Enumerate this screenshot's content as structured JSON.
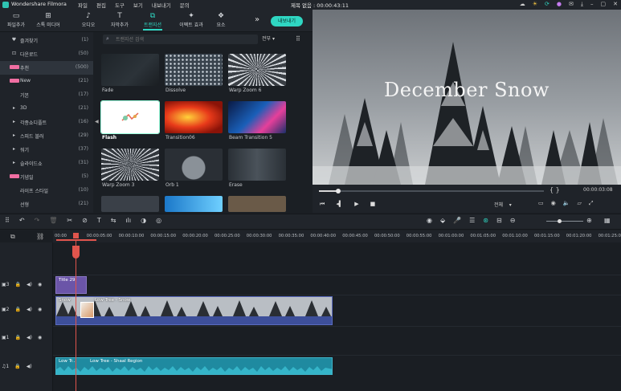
{
  "app": {
    "name": "Wondershare Filmora",
    "menu": [
      "파일",
      "편집",
      "도구",
      "보기",
      "내보내기",
      "문의"
    ],
    "project_title": "제목 없음 : 00:00:43:11"
  },
  "toolbar": {
    "items": [
      {
        "label": "파일추가",
        "icon": "folder-icon"
      },
      {
        "label": "스톡 미디어",
        "icon": "stock-icon"
      },
      {
        "label": "오디오",
        "icon": "music-icon"
      },
      {
        "label": "자막추가",
        "icon": "text-icon"
      },
      {
        "label": "트랜지션",
        "icon": "transition-icon",
        "active": true
      },
      {
        "label": "이펙트 효과",
        "icon": "effects-icon"
      },
      {
        "label": "요소",
        "icon": "elements-icon"
      }
    ],
    "export_label": "내보내기"
  },
  "categories": [
    {
      "icon": "heart-icon",
      "label": "즐겨찾기",
      "count": "(1)"
    },
    {
      "icon": "download-icon",
      "label": "다운로드",
      "count": "(50)"
    },
    {
      "tag": "HOT",
      "label": "추천",
      "count": "(500)",
      "selected": true
    },
    {
      "tag": "NEW",
      "label": "New",
      "count": "(21)"
    },
    {
      "label": "기본",
      "count": "(17)",
      "indent": true
    },
    {
      "arrow": true,
      "label": "3D",
      "count": "(21)"
    },
    {
      "arrow": true,
      "label": "각종쇼디플트",
      "count": "(16)"
    },
    {
      "arrow": true,
      "label": "스피드 블러",
      "count": "(29)"
    },
    {
      "arrow": true,
      "label": "워기",
      "count": "(37)"
    },
    {
      "arrow": true,
      "label": "슬라이드쇼",
      "count": "(31)"
    },
    {
      "tag": "HOT",
      "label": "기념일",
      "count": "(5)"
    },
    {
      "label": "라이프 스타일",
      "count": "(10)",
      "indent": true
    },
    {
      "label": "선형",
      "count": "(21)",
      "indent": true
    }
  ],
  "search": {
    "placeholder": "트랜지션 검색",
    "filter": "전부"
  },
  "thumbnails": [
    {
      "name": "Fade"
    },
    {
      "name": "Dissolve"
    },
    {
      "name": "Warp Zoom 6"
    },
    {
      "name": "Flash",
      "selected": true
    },
    {
      "name": "Transition06"
    },
    {
      "name": "Beam Transition 5"
    },
    {
      "name": "Warp Zoom 3"
    },
    {
      "name": "Orb 1"
    },
    {
      "name": "Erase"
    }
  ],
  "preview": {
    "overlay_title": "December Snow",
    "braces": "{   }",
    "timecode": "00:00:03:08",
    "quality": "전체",
    "progress": 0.08
  },
  "ruler": {
    "ticks": [
      "00:00",
      "00:00:05:00",
      "00:00:10:00",
      "00:00:15:00",
      "00:00:20:00",
      "00:00:25:00",
      "00:00:30:00",
      "00:00:35:00",
      "00:00:40:00",
      "00:00:45:00",
      "00:00:50:00",
      "00:00:55:00",
      "00:01:00:00",
      "00:01:05:00",
      "00:01:10:00",
      "00:01:15:00",
      "00:01:20:00",
      "00:01:25:00"
    ]
  },
  "tracks": [
    {
      "id": "3",
      "kind": "text"
    },
    {
      "id": "2",
      "kind": "video"
    },
    {
      "id": "1",
      "kind": "video"
    },
    {
      "id": "1",
      "kind": "audio"
    }
  ],
  "clips": {
    "title": "Title 29",
    "video_a": "Snow",
    "video_b": "Low Tree - Snow",
    "audio_a": "Low Tr...",
    "audio_b": "Low Tree - Shaal Region"
  },
  "colors": {
    "accent": "#2fd6c2",
    "title_clip": "#6b55a8",
    "video_clip": "#3d4f9a",
    "audio_clip": "#1f8aa0",
    "playhead": "#e0554d",
    "hot_tag": "#f06ea2"
  }
}
